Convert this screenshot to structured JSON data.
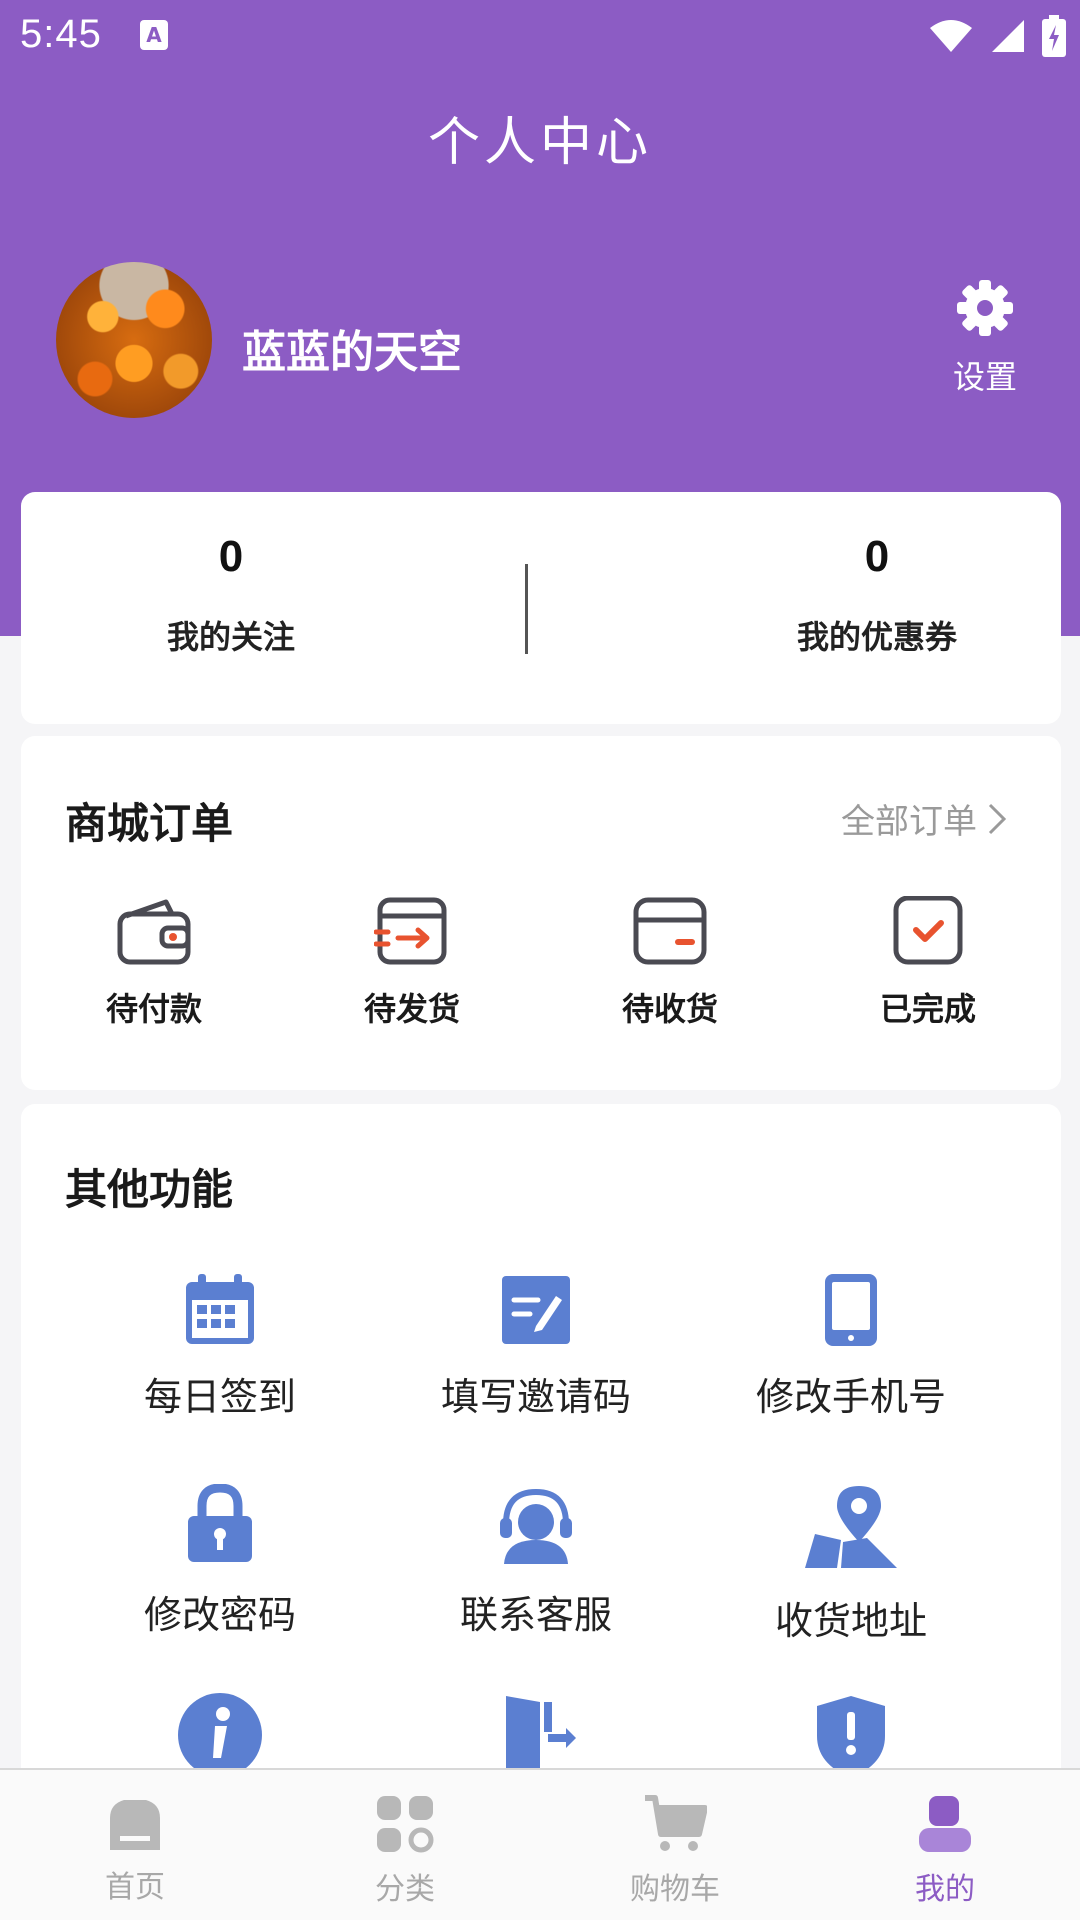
{
  "status_bar": {
    "time": "5:45",
    "notification_icon": "A"
  },
  "header": {
    "title": "个人中心"
  },
  "profile": {
    "username": "蓝蓝的天空",
    "settings_label": "设置"
  },
  "stats": [
    {
      "value": "0",
      "label": "我的关注"
    },
    {
      "value": "0",
      "label": "我的优惠券"
    }
  ],
  "orders": {
    "title": "商城订单",
    "all_label": "全部订单",
    "items": [
      {
        "label": "待付款",
        "icon": "wallet-icon"
      },
      {
        "label": "待发货",
        "icon": "shipping-box-icon"
      },
      {
        "label": "待收货",
        "icon": "card-receive-icon"
      },
      {
        "label": "已完成",
        "icon": "check-icon"
      }
    ]
  },
  "features": {
    "title": "其他功能",
    "items": [
      {
        "label": "每日签到",
        "icon": "calendar-icon"
      },
      {
        "label": "填写邀请码",
        "icon": "edit-icon"
      },
      {
        "label": "修改手机号",
        "icon": "phone-icon"
      },
      {
        "label": "修改密码",
        "icon": "lock-icon"
      },
      {
        "label": "联系客服",
        "icon": "headset-icon"
      },
      {
        "label": "收货地址",
        "icon": "map-pin-icon"
      }
    ]
  },
  "bottom_nav": [
    {
      "label": "首页",
      "icon": "home-icon"
    },
    {
      "label": "分类",
      "icon": "category-icon"
    },
    {
      "label": "购物车",
      "icon": "cart-icon"
    },
    {
      "label": "我的",
      "icon": "profile-icon",
      "active": true
    }
  ],
  "colors": {
    "primary": "#8c5cc4",
    "icon_blue": "#5b7fd1",
    "accent_red": "#e8532f"
  }
}
